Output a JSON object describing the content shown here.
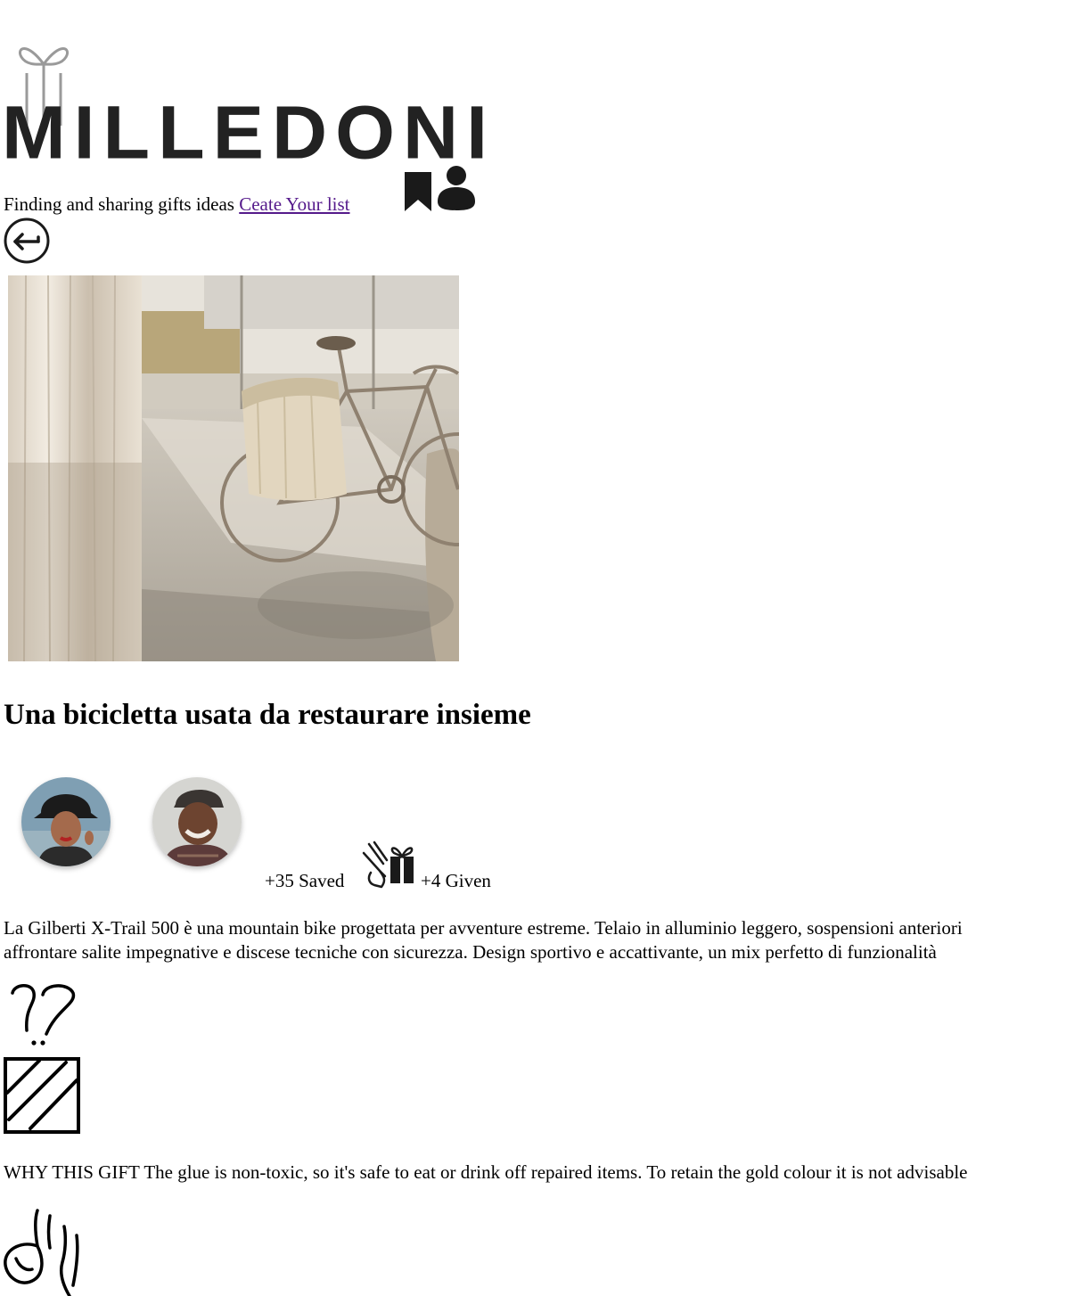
{
  "header": {
    "logo_text": "MILLEDONI",
    "tagline": "Finding and sharing gifts ideas",
    "create_list_link": "Ceate Your list",
    "icons": [
      "bookmark-icon",
      "user-icon"
    ]
  },
  "navigation": {
    "back_icon": "back-arrow-icon"
  },
  "product": {
    "image_subject": "bicycle",
    "title": "Una bicicletta usata da restaurare insieme",
    "stats": {
      "saved": "+35 Saved",
      "given": "+4 Given"
    },
    "description_lines": [
      "La Gilberti X-Trail 500 è una mountain bike progettata per avventure estreme. Telaio in alluminio leggero, sospensioni anteriori",
      "affrontare salite impegnative e discese tecniche con sicurezza. Design sportivo e accattivante, un mix perfetto di funzionalità"
    ],
    "why_this_gift": "WHY THIS GIFT The glue is non-toxic, so it's safe to eat or drink off repaired items. To retain the gold colour it is not advisable"
  },
  "colors": {
    "logo": "#222222",
    "link": "#551a8b",
    "icon": "#1a1a1a"
  }
}
